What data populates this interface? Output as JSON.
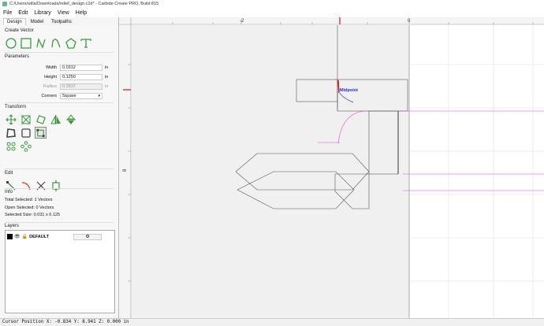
{
  "window": {
    "title": "C:/Users/willa/Downloads/relief_design.c2d* - Carbide Create PRO, Build 815"
  },
  "menu": [
    "File",
    "Edit",
    "Library",
    "View",
    "Help"
  ],
  "tabs": [
    "Design",
    "Model",
    "Toolpaths"
  ],
  "create_vector": {
    "title": "Create Vector"
  },
  "parameters": {
    "title": "Parameters",
    "width_label": "Width",
    "width_value": "0.0312",
    "width_unit": "in",
    "height_label": "Height",
    "height_value": "0.1250",
    "height_unit": "in",
    "radius_label": "Radius",
    "radius_value": "0.3937",
    "radius_unit": "in",
    "corners_label": "Corners",
    "corners_value": "Square"
  },
  "transform": {
    "title": "Transform"
  },
  "edit": {
    "title": "Edit"
  },
  "info": {
    "title": "Info",
    "total_selected": "Total Selected:   1 Vectors",
    "open_selected": "Open Selected:   0 Vectors",
    "selected_size": "Selected Size:    0.031 x 0.125"
  },
  "layers": {
    "title": "Layers",
    "layer_name": "DEFAULT",
    "gear": "⚙"
  },
  "canvas": {
    "ruler_x_labels": [
      "-2",
      "0"
    ],
    "ruler_y_label": "8",
    "midpoint_label": "Midpoint"
  },
  "status": {
    "cursor": "Cursor Position X: -0.834 Y: 8.941 Z: 0.000 in"
  },
  "colors": {
    "accent_green": "#3c9a3c",
    "selection_red": "#e01010",
    "guide_magenta": "#e040e0",
    "snap_blue": "#1a2ee0"
  }
}
